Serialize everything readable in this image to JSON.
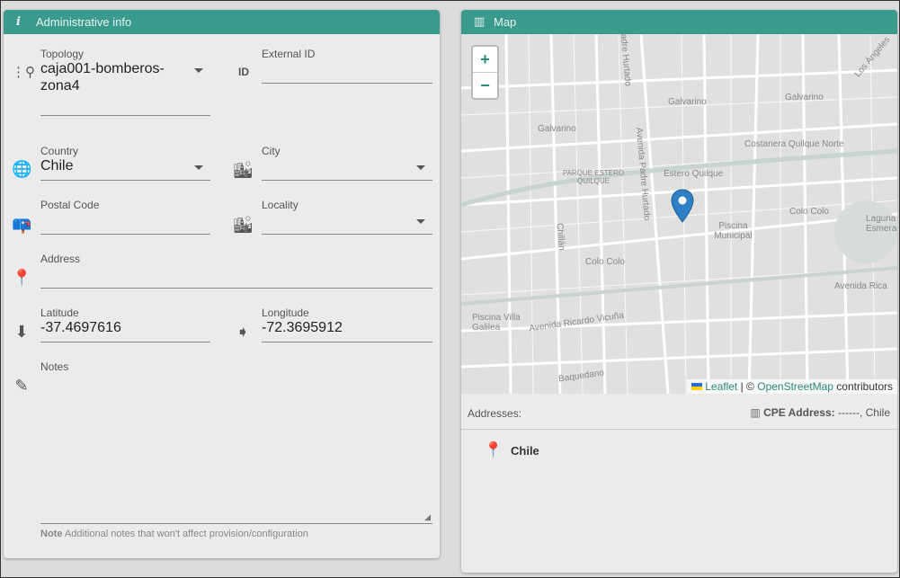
{
  "admin": {
    "title": "Administrative info",
    "icon": "info-icon",
    "topology": {
      "label": "Topology",
      "value": "caja001-bomberos-zona4"
    },
    "external_id": {
      "label": "External ID",
      "value": ""
    },
    "country": {
      "label": "Country",
      "value": "Chile"
    },
    "city": {
      "label": "City",
      "value": ""
    },
    "postal_code": {
      "label": "Postal Code",
      "value": ""
    },
    "locality": {
      "label": "Locality",
      "value": ""
    },
    "address": {
      "label": "Address",
      "value": ""
    },
    "latitude": {
      "label": "Latitude",
      "value": "-37.4697616"
    },
    "longitude": {
      "label": "Longitude",
      "value": "-72.3695912"
    },
    "notes": {
      "label": "Notes",
      "value": "",
      "hint_bold": "Note",
      "hint": "Additional notes that won't affect provision/configuration"
    }
  },
  "map": {
    "title": "Map",
    "zoom_in": "+",
    "zoom_out": "−",
    "labels": [
      "Galvarino",
      "Galvarino",
      "Galvarino",
      "Costanera Quilque Norte",
      "PARQUE ESTERO QUILQUE",
      "Estero Quilque",
      "Piscina Municipal",
      "Colo Colo",
      "Colo Colo",
      "Avenida Padre Hurtado",
      "Chillán",
      "Avenida Ricardo Vicuña",
      "Piscina Villa Galilea",
      "Baquedano",
      "Avenida Rica",
      "Los Ángeles",
      "Laguna Esmeralda",
      "Padre Hurtado"
    ],
    "attribution": {
      "leaflet": "Leaflet",
      "sep": "| ©",
      "osm": "OpenStreetMap",
      "contributors": "contributors"
    }
  },
  "addresses": {
    "label": "Addresses:",
    "cpe_label": "CPE Address:",
    "cpe_value": "------, Chile",
    "items": [
      "Chile"
    ]
  },
  "colors": {
    "header": "#3a9a8b",
    "marker": "#2e7fc4",
    "link": "#2a8a7c"
  }
}
